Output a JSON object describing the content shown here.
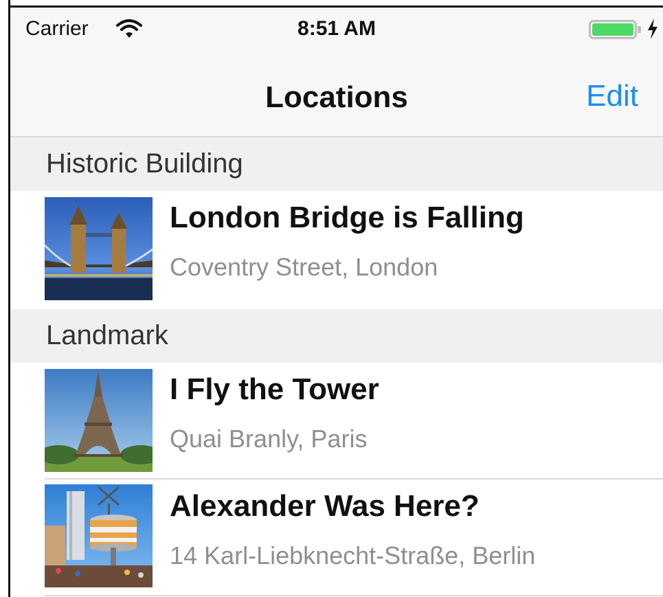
{
  "status_bar": {
    "carrier": "Carrier",
    "time": "8:51 AM",
    "battery_color": "#4cd964"
  },
  "nav": {
    "title": "Locations",
    "edit_label": "Edit",
    "accent_color": "#1a8ef0"
  },
  "sections": [
    {
      "title": "Historic Building",
      "rows": [
        {
          "title": "London Bridge is Falling",
          "subtitle": "Coventry Street, London",
          "thumbnail": "tower-bridge-photo"
        }
      ]
    },
    {
      "title": "Landmark",
      "rows": [
        {
          "title": "I Fly the Tower",
          "subtitle": "Quai Branly, Paris",
          "thumbnail": "eiffel-tower-photo"
        },
        {
          "title": "Alexander Was Here?",
          "subtitle": "14 Karl-Liebknecht-Straße, Berlin",
          "thumbnail": "world-clock-photo"
        }
      ]
    }
  ]
}
